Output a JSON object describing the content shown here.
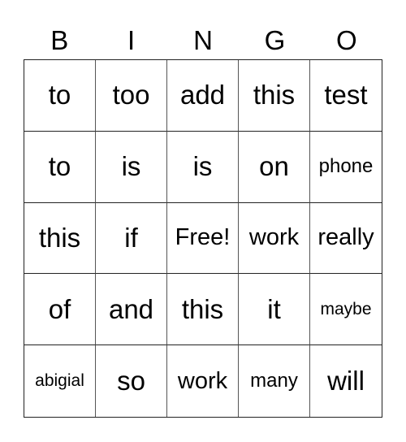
{
  "header": [
    "B",
    "I",
    "N",
    "G",
    "O"
  ],
  "cells": [
    "to",
    "too",
    "add",
    "this",
    "test",
    "to",
    "is",
    "is",
    "on",
    "phone",
    "this",
    "if",
    "Free!",
    "work",
    "really",
    "of",
    "and",
    "this",
    "it",
    "maybe",
    "abigial",
    "so",
    "work",
    "many",
    "will"
  ]
}
